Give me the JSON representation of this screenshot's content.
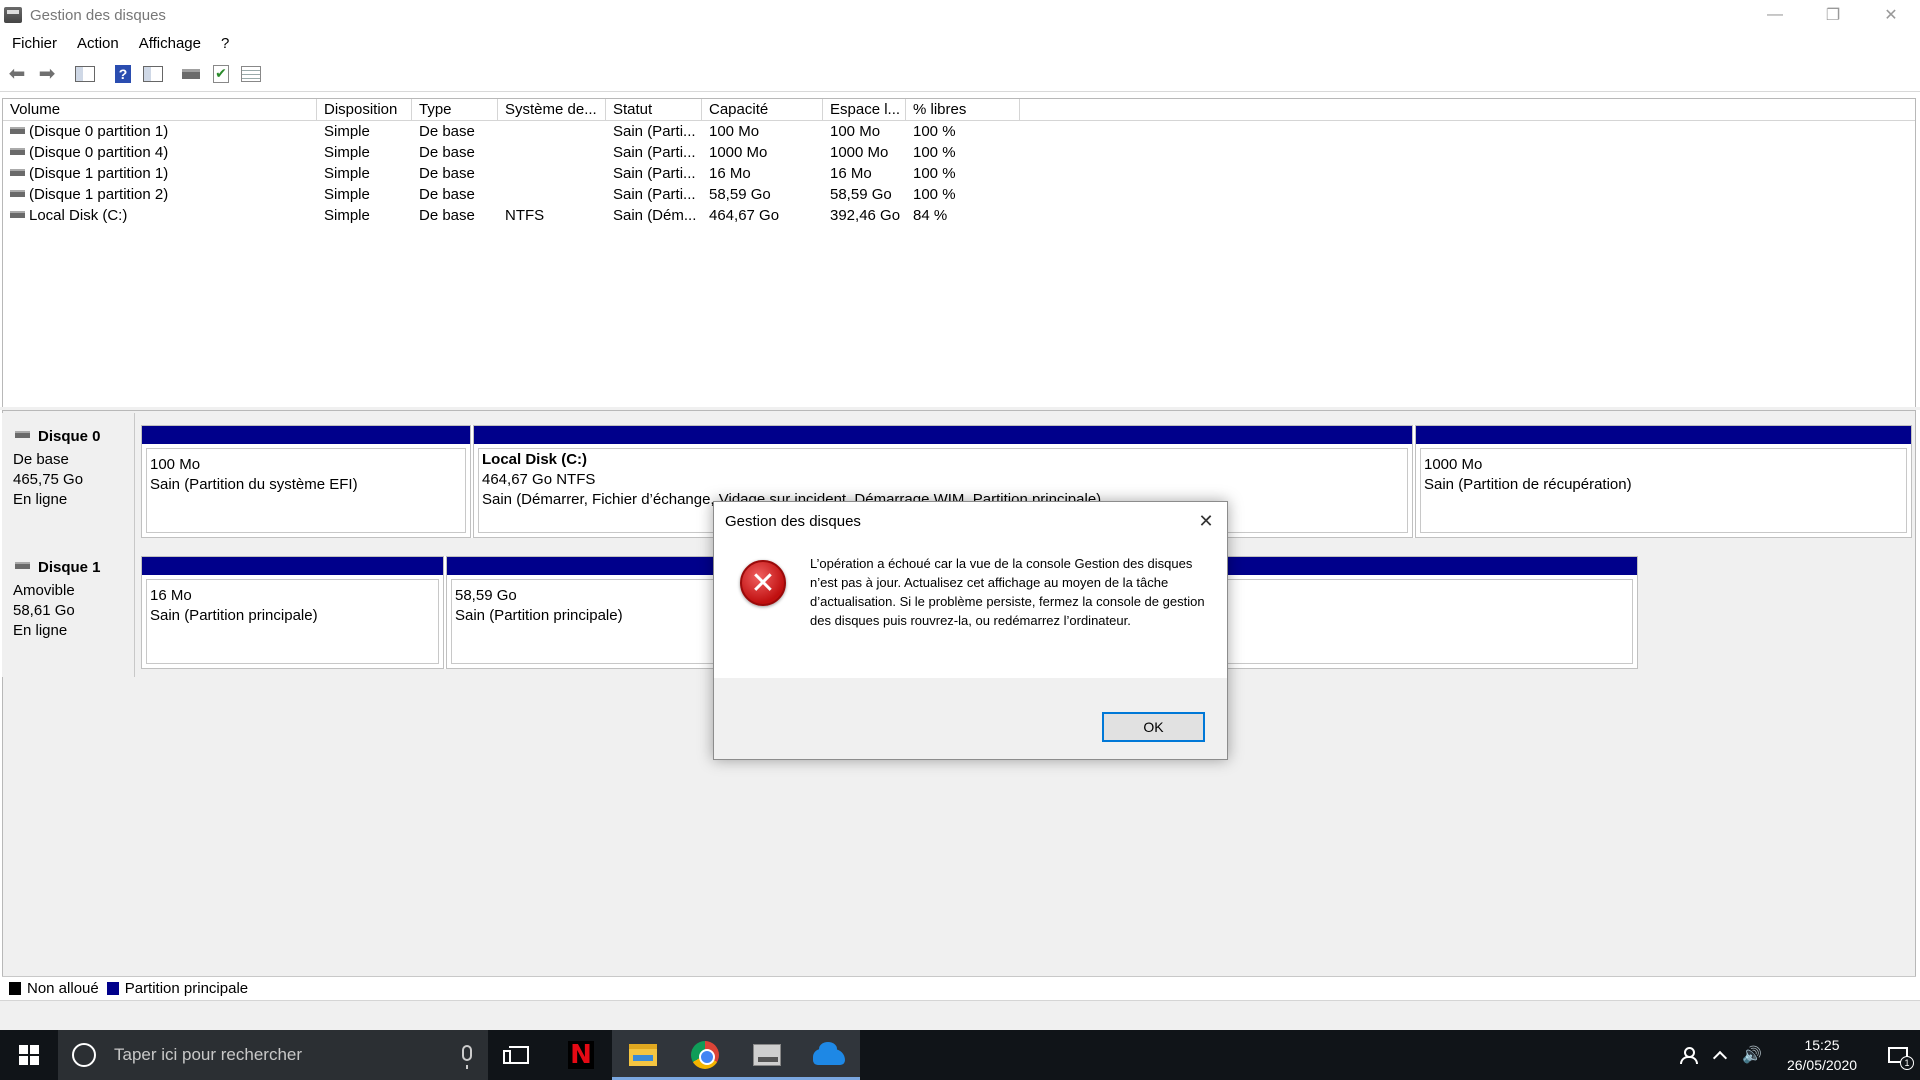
{
  "window": {
    "title": "Gestion des disques",
    "controls": {
      "minimize": "—",
      "restore": "❐",
      "close": "✕"
    }
  },
  "menu": [
    "Fichier",
    "Action",
    "Affichage",
    "?"
  ],
  "toolbar": {
    "icons": [
      "back-arrow-icon",
      "forward-arrow-icon",
      "console-tree-icon",
      "help-icon",
      "show-panel-icon",
      "disk-connect-icon",
      "check-properties-icon",
      "list-view-icon"
    ],
    "back": "⬅",
    "forward": "➡",
    "help": "?",
    "check": "✔"
  },
  "volume_list": {
    "columns": [
      "Volume",
      "Disposition",
      "Type",
      "Système de...",
      "Statut",
      "Capacité",
      "Espace l...",
      "% libres"
    ],
    "rows": [
      {
        "volume": "(Disque 0 partition 1)",
        "layout": "Simple",
        "type": "De base",
        "fs": "",
        "status": "Sain (Parti...",
        "capacity": "100 Mo",
        "free": "100 Mo",
        "pct": "100 %"
      },
      {
        "volume": "(Disque 0 partition 4)",
        "layout": "Simple",
        "type": "De base",
        "fs": "",
        "status": "Sain (Parti...",
        "capacity": "1000 Mo",
        "free": "1000 Mo",
        "pct": "100 %"
      },
      {
        "volume": "(Disque 1 partition 1)",
        "layout": "Simple",
        "type": "De base",
        "fs": "",
        "status": "Sain (Parti...",
        "capacity": "16 Mo",
        "free": "16 Mo",
        "pct": "100 %"
      },
      {
        "volume": "(Disque 1 partition 2)",
        "layout": "Simple",
        "type": "De base",
        "fs": "",
        "status": "Sain (Parti...",
        "capacity": "58,59 Go",
        "free": "58,59 Go",
        "pct": "100 %"
      },
      {
        "volume": "Local Disk (C:)",
        "layout": "Simple",
        "type": "De base",
        "fs": "NTFS",
        "status": "Sain (Dém...",
        "capacity": "464,67 Go",
        "free": "392,46 Go",
        "pct": "84 %"
      }
    ]
  },
  "disks": [
    {
      "name": "Disque 0",
      "kind": "De base",
      "size": "465,75 Go",
      "state": "En ligne",
      "partitions": [
        {
          "title": "",
          "line1": "100 Mo",
          "line2": "Sain (Partition du système EFI)"
        },
        {
          "title": "Local Disk  (C:)",
          "line1": "464,67 Go NTFS",
          "line2": "Sain (Démarrer, Fichier d’échange, Vidage sur incident, Démarrage WIM, Partition principale)"
        },
        {
          "title": "",
          "line1": "1000 Mo",
          "line2": "Sain (Partition de récupération)"
        }
      ]
    },
    {
      "name": "Disque 1",
      "kind": "Amovible",
      "size": "58,61 Go",
      "state": "En ligne",
      "partitions": [
        {
          "title": "",
          "line1": "16 Mo",
          "line2": "Sain (Partition principale)"
        },
        {
          "title": "",
          "line1": "58,59 Go",
          "line2": "Sain (Partition principale)"
        }
      ]
    }
  ],
  "legend": [
    {
      "label": "Non alloué",
      "color": "#000000"
    },
    {
      "label": "Partition principale",
      "color": "#00008b"
    }
  ],
  "dialog": {
    "title": "Gestion des disques",
    "close": "✕",
    "icon": "error-icon",
    "icon_glyph": "✕",
    "message": "L’opération a échoué car la vue de la console Gestion des disques n’est pas à jour. Actualisez cet affichage au moyen de la tâche d’actualisation. Si le problème persiste, fermez la console de gestion des disques puis rouvrez-la, ou redémarrez l’ordinateur.",
    "ok_label": "OK"
  },
  "taskbar": {
    "search_placeholder": "Taper ici pour rechercher",
    "apps": [
      "task-view-icon",
      "netflix-icon",
      "file-explorer-icon",
      "chrome-icon",
      "disk-management-icon",
      "onedrive-icon"
    ],
    "netflix_glyph": "N",
    "speaker_glyph": "🔊",
    "time": "15:25",
    "date": "26/05/2020",
    "notification_count": "1"
  }
}
